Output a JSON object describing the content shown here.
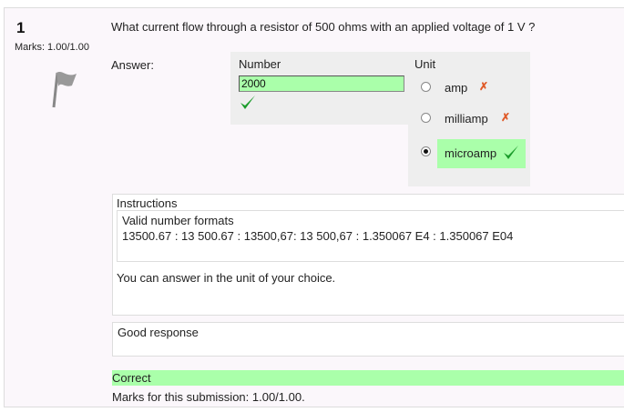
{
  "question": {
    "number": "1",
    "marks": "Marks: 1.00/1.00",
    "text": "What current flow through a resistor of 500 ohms with an applied voltage of 1 V ?",
    "answer_label": "Answer:"
  },
  "number_panel": {
    "title": "Number",
    "value": "2000"
  },
  "unit_panel": {
    "title": "Unit",
    "options": [
      {
        "label": "amp",
        "selected": false,
        "status": "incorrect"
      },
      {
        "label": "milliamp",
        "selected": false,
        "status": "incorrect"
      },
      {
        "label": "microamp",
        "selected": true,
        "status": "correct"
      }
    ]
  },
  "instructions": {
    "title": "Instructions",
    "formats_title": "Valid number formats",
    "formats": "13500.67 : 13 500.67 : 13500,67: 13 500,67 : 1.350067 E4 : 1.350067 E04",
    "note": "You can answer in the unit of your choice."
  },
  "feedback": {
    "text": "Good response"
  },
  "result": {
    "status": "Correct",
    "marks_line": "Marks for this submission: 1.00/1.00."
  },
  "colors": {
    "correct_bg": "#aaffaa",
    "incorrect_mark": "#e05a28",
    "check": "#1a9c2a"
  }
}
